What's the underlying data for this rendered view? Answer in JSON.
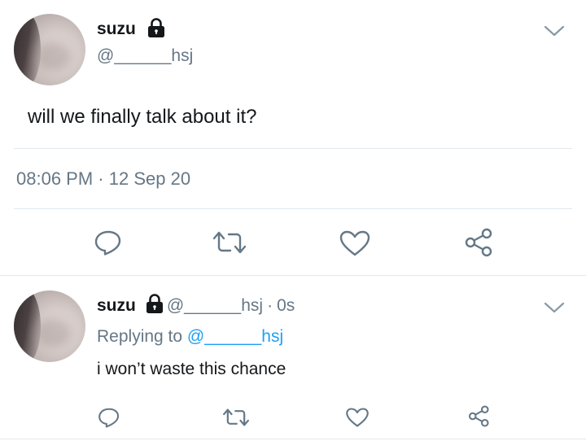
{
  "main_tweet": {
    "display_name": "suzu",
    "handle": "@______hsj",
    "text": "will we finally talk about it?",
    "time": "08:06 PM",
    "separator": "·",
    "date": "12 Sep 20"
  },
  "reply_tweet": {
    "display_name": "suzu",
    "handle": "@______hsj",
    "dot": "·",
    "age": "0s",
    "replying_prefix": "Replying to",
    "replying_handle": "@______hsj",
    "text": "i won’t waste this chance"
  },
  "colors": {
    "text": "#14171a",
    "muted": "#657786",
    "link": "#1da1f2",
    "divider": "#e1e8ed"
  },
  "icons": [
    "lock-icon",
    "chevron-down-icon",
    "reply-icon",
    "retweet-icon",
    "like-icon",
    "share-icon"
  ]
}
